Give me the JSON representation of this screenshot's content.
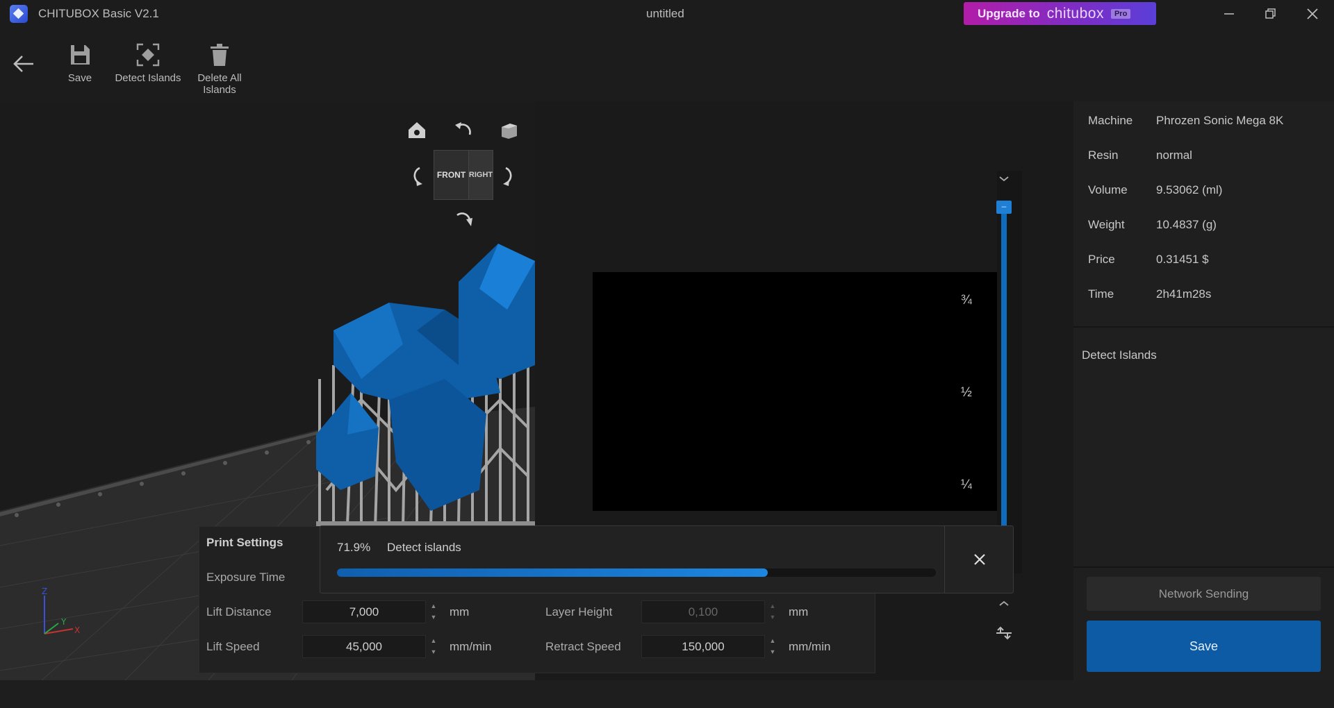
{
  "app": {
    "title": "CHITUBOX Basic V2.1",
    "document_title": "untitled",
    "upgrade": {
      "prefix": "Upgrade to",
      "brand": "chitubox",
      "badge": "Pro"
    }
  },
  "toolbar": {
    "save_label": "Save",
    "detect_label": "Detect Islands",
    "delete_label_1": "Delete All",
    "delete_label_2": "Islands"
  },
  "viewcube": {
    "front": "FRONT",
    "right": "RIGHT"
  },
  "preview": {
    "marks": [
      "¾",
      "½",
      "¼"
    ]
  },
  "info": {
    "rows": [
      {
        "key": "Machine",
        "value": "Phrozen Sonic Mega 8K"
      },
      {
        "key": "Resin",
        "value": "normal"
      },
      {
        "key": "Volume",
        "value": "9.53062 (ml)"
      },
      {
        "key": "Weight",
        "value": "10.4837 (g)"
      },
      {
        "key": "Price",
        "value": "0.31451 $"
      },
      {
        "key": "Time",
        "value": "2h41m28s"
      }
    ]
  },
  "islands_panel": {
    "title": "Detect Islands"
  },
  "actions": {
    "network_label": "Network Sending",
    "save_label": "Save"
  },
  "print_settings": {
    "title": "Print Settings",
    "exposure_label": "Exposure Time",
    "lift_distance": {
      "label": "Lift Distance",
      "value": "7,000",
      "unit": "mm"
    },
    "lift_speed": {
      "label": "Lift Speed",
      "value": "45,000",
      "unit": "mm/min"
    },
    "layer_height": {
      "label": "Layer Height",
      "value": "0,100",
      "unit": "mm"
    },
    "retract_speed": {
      "label": "Retract Speed",
      "value": "150,000",
      "unit": "mm/min"
    }
  },
  "progress": {
    "percent_text": "71.9%",
    "fraction": 0.719,
    "label": "Detect islands"
  },
  "axes": {
    "x": "X",
    "y": "Y",
    "z": "Z"
  },
  "colors": {
    "accent": "#0d5aa5",
    "model": "#0f5fa8",
    "supports": "#9a9a9a"
  }
}
